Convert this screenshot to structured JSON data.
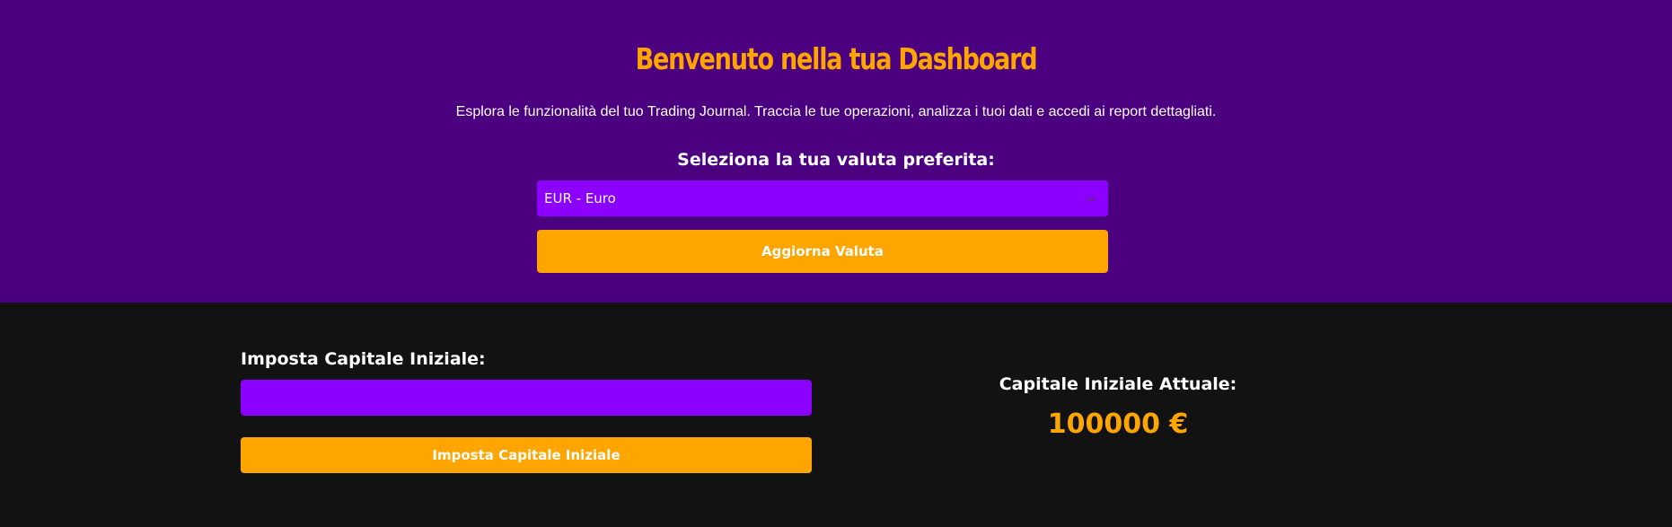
{
  "hero": {
    "title": "Benvenuto nella tua Dashboard",
    "subtitle": "Esplora le funzionalità del tuo Trading Journal. Traccia le tue operazioni, analizza i tuoi dati e accedi ai report dettagliati.",
    "currency_label": "Seleziona la tua valuta preferita:",
    "currency_selected": "EUR - Euro",
    "update_button_label": "Aggiorna Valuta"
  },
  "capital": {
    "label": "Imposta Capitale Iniziale:",
    "input_value": "",
    "button_label": "Imposta Capitale Iniziale",
    "current_label": "Capitale Iniziale Attuale:",
    "current_value": "100000 €"
  },
  "colors": {
    "hero_bg": "#4b0080",
    "accent": "#ffa500",
    "input_bg": "#8c00ff",
    "bottom_bg": "#121212"
  },
  "icons": {
    "select_chevron": "chevron-down-icon"
  }
}
